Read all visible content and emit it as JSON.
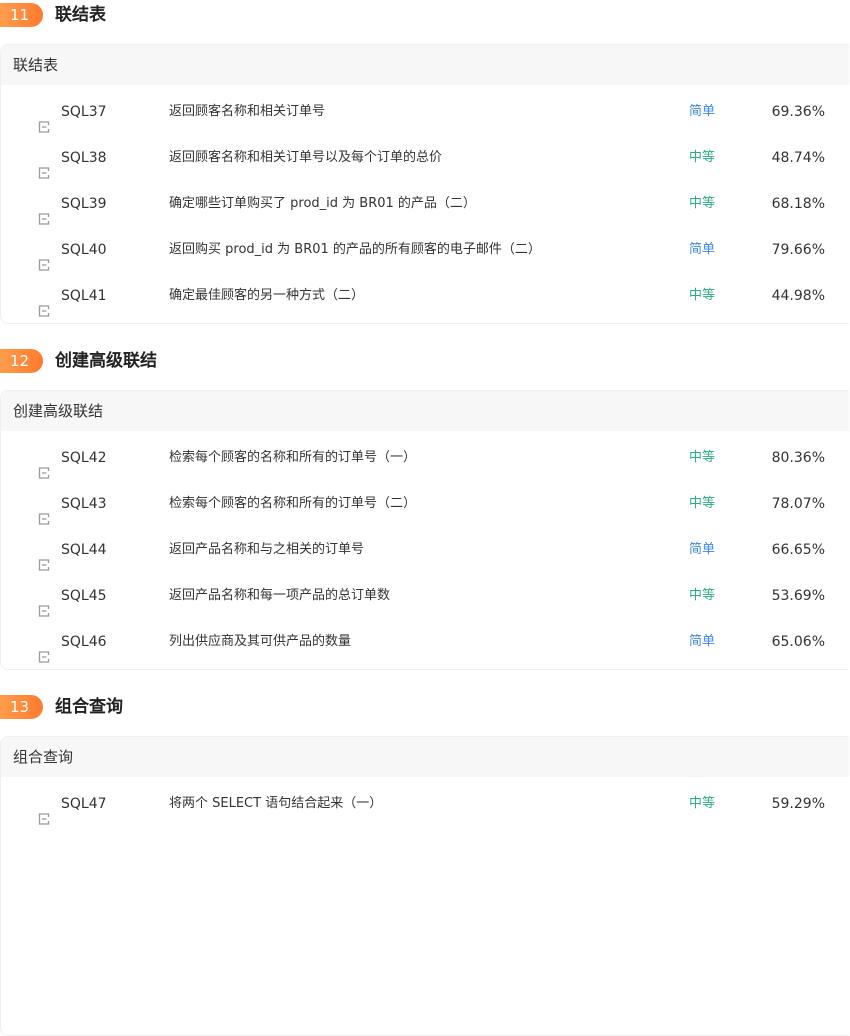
{
  "colors": {
    "easy": "#3f87e0",
    "medium": "#28b07f",
    "badge_start": "#ff9d4d",
    "badge_end": "#ff7a2e"
  },
  "icons": {
    "row": "file-edit-icon"
  },
  "sections": [
    {
      "number": "11",
      "title": "联结表",
      "group": "联结表",
      "rows": [
        {
          "id": "SQL37",
          "title": "返回顾客名称和相关订单号",
          "difficulty": "简单",
          "level": "easy",
          "pass_rate": "69.36%"
        },
        {
          "id": "SQL38",
          "title": "返回顾客名称和相关订单号以及每个订单的总价",
          "difficulty": "中等",
          "level": "medium",
          "pass_rate": "48.74%"
        },
        {
          "id": "SQL39",
          "title": "确定哪些订单购买了 prod_id 为 BR01 的产品（二）",
          "difficulty": "中等",
          "level": "medium",
          "pass_rate": "68.18%"
        },
        {
          "id": "SQL40",
          "title": "返回购买 prod_id 为 BR01 的产品的所有顾客的电子邮件（二）",
          "difficulty": "简单",
          "level": "easy",
          "pass_rate": "79.66%"
        },
        {
          "id": "SQL41",
          "title": "确定最佳顾客的另一种方式（二）",
          "difficulty": "中等",
          "level": "medium",
          "pass_rate": "44.98%"
        }
      ]
    },
    {
      "number": "12",
      "title": "创建高级联结",
      "group": "创建高级联结",
      "rows": [
        {
          "id": "SQL42",
          "title": "检索每个顾客的名称和所有的订单号（一）",
          "difficulty": "中等",
          "level": "medium",
          "pass_rate": "80.36%"
        },
        {
          "id": "SQL43",
          "title": "检索每个顾客的名称和所有的订单号（二）",
          "difficulty": "中等",
          "level": "medium",
          "pass_rate": "78.07%"
        },
        {
          "id": "SQL44",
          "title": "返回产品名称和与之相关的订单号",
          "difficulty": "简单",
          "level": "easy",
          "pass_rate": "66.65%"
        },
        {
          "id": "SQL45",
          "title": "返回产品名称和每一项产品的总订单数",
          "difficulty": "中等",
          "level": "medium",
          "pass_rate": "53.69%"
        },
        {
          "id": "SQL46",
          "title": "列出供应商及其可供产品的数量",
          "difficulty": "简单",
          "level": "easy",
          "pass_rate": "65.06%"
        }
      ]
    },
    {
      "number": "13",
      "title": "组合查询",
      "group": "组合查询",
      "rows": [
        {
          "id": "SQL47",
          "title": "将两个 SELECT 语句结合起来（一）",
          "difficulty": "中等",
          "level": "medium",
          "pass_rate": "59.29%"
        }
      ]
    }
  ]
}
